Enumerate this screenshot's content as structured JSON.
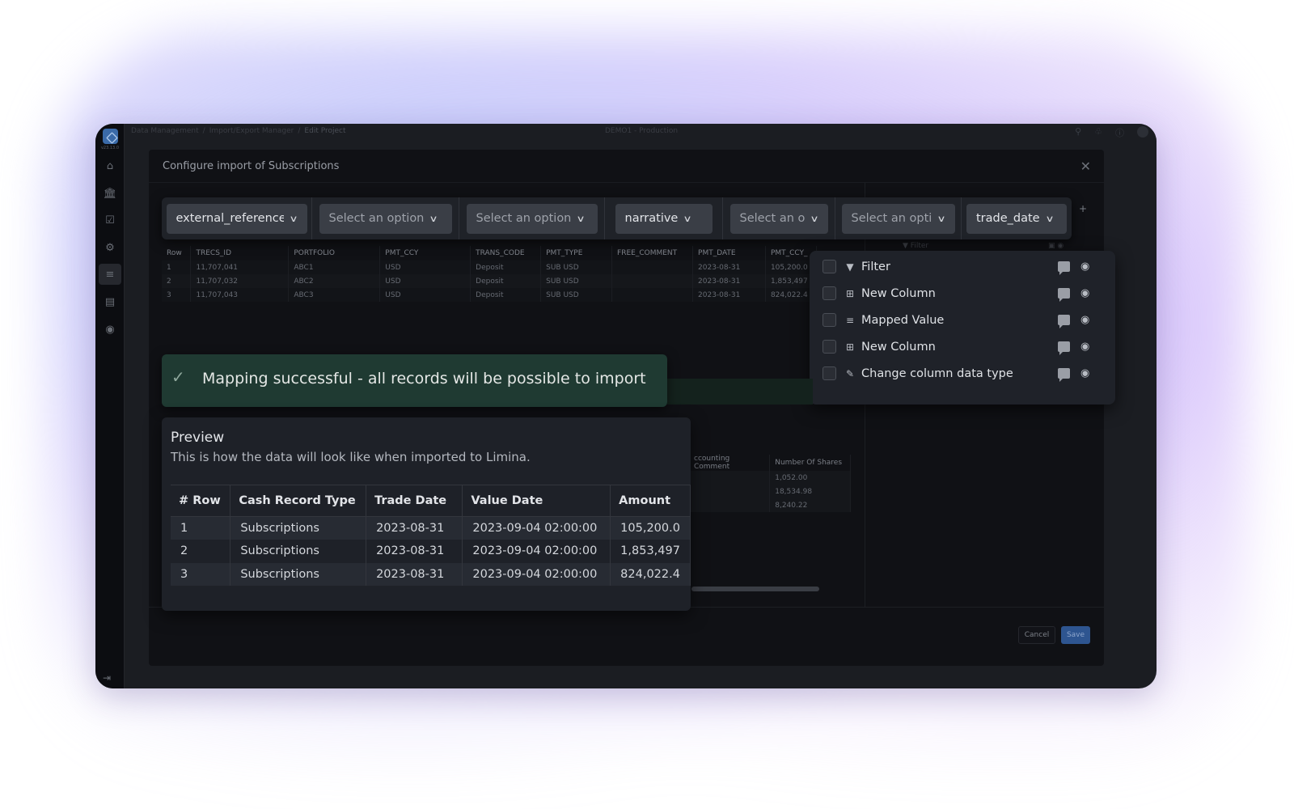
{
  "app": {
    "version": "v23.13.0",
    "environment": "DEMO1 - Production",
    "breadcrumb": [
      "Data Management",
      "Import/Export Manager",
      "Edit Project"
    ]
  },
  "sidebar": {
    "items": [
      {
        "icon": "home-icon",
        "active": false
      },
      {
        "icon": "bank-icon",
        "active": false
      },
      {
        "icon": "clipboard-check-icon",
        "active": false
      },
      {
        "icon": "gears-icon",
        "active": false
      },
      {
        "icon": "import-export-icon",
        "active": true
      },
      {
        "icon": "document-icon",
        "active": false
      },
      {
        "icon": "shield-gear-icon",
        "active": false
      }
    ],
    "collapse_icon": "collapse-sidebar-icon"
  },
  "topbar_icons": [
    "search-icon",
    "bell-icon",
    "help-icon",
    "avatar"
  ],
  "modal": {
    "title": "Configure import of Subscriptions",
    "cancel_label": "Cancel",
    "save_label": "Save"
  },
  "mapping": {
    "placeholder": "Select an option",
    "columns": [
      {
        "value": "external_reference",
        "display": "external_reference"
      },
      {
        "value": "",
        "display": "Select an option"
      },
      {
        "value": "",
        "display": "Select an option"
      },
      {
        "value": "narrative",
        "display": "narrative"
      },
      {
        "value": "",
        "display": "Select an op"
      },
      {
        "value": "",
        "display": "Select an optic"
      },
      {
        "value": "trade_date",
        "display": "trade_date"
      }
    ],
    "add_label": "+"
  },
  "raw_table": {
    "headers": [
      "Row",
      "TRECS_ID",
      "PORTFOLIO",
      "PMT_CCY",
      "TRANS_CODE",
      "PMT_TYPE",
      "FREE_COMMENT",
      "PMT_DATE",
      "PMT_CCY_"
    ],
    "rows": [
      [
        "1",
        "11,707,041",
        "ABC1",
        "USD",
        "Deposit",
        "SUB USD",
        "",
        "2023-08-31",
        "105,200.0"
      ],
      [
        "2",
        "11,707,032",
        "ABC2",
        "USD",
        "Deposit",
        "SUB USD",
        "",
        "2023-08-31",
        "1,853,497"
      ],
      [
        "3",
        "11,707,043",
        "ABC3",
        "USD",
        "Deposit",
        "SUB USD",
        "",
        "2023-08-31",
        "824,022.4"
      ]
    ]
  },
  "transforms": {
    "ghost_label": "Filter",
    "items": [
      {
        "label": "Filter",
        "icon": "filter-icon",
        "checked": false
      },
      {
        "label": "New Column",
        "icon": "new-column-icon",
        "checked": false
      },
      {
        "label": "Mapped Value",
        "icon": "mapped-value-icon",
        "checked": false
      },
      {
        "label": "New Column",
        "icon": "new-column-icon",
        "checked": false
      },
      {
        "label": "Change column data type",
        "icon": "pencil-icon",
        "checked": false
      }
    ]
  },
  "success": {
    "message": "Mapping successful - all records will be possible to import"
  },
  "preview": {
    "title": "Preview",
    "subtitle": "This is how the data will look like when imported to Limina.",
    "headers": [
      "# Row",
      "Cash Record Type",
      "Trade Date",
      "Value Date",
      "Amount"
    ],
    "rows": [
      [
        "1",
        "Subscriptions",
        "2023-08-31",
        "2023-09-04 02:00:00",
        "105,200.0"
      ],
      [
        "2",
        "Subscriptions",
        "2023-08-31",
        "2023-09-04 02:00:00",
        "1,853,497"
      ],
      [
        "3",
        "Subscriptions",
        "2023-08-31",
        "2023-09-04 02:00:00",
        "824,022.4"
      ]
    ]
  },
  "background_table": {
    "headers": [
      "ccounting Comment",
      "Number Of Shares"
    ],
    "rows": [
      [
        "",
        "1,052.00"
      ],
      [
        "",
        "18,534.98"
      ],
      [
        "",
        "8,240.22"
      ]
    ]
  }
}
